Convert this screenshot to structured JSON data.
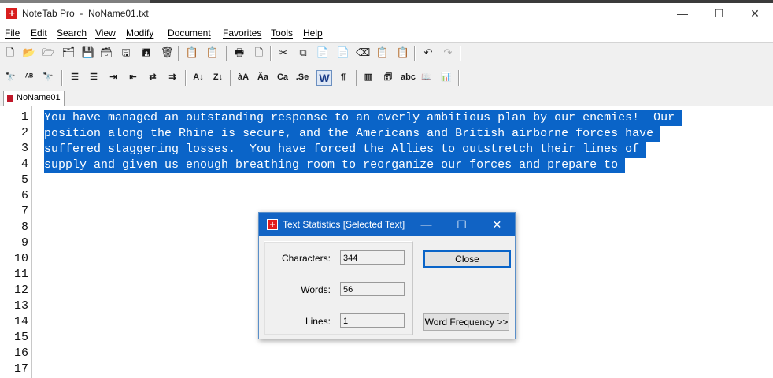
{
  "window": {
    "title": "NoteTab Pro  -  NoName01.txt",
    "controls": [
      "—",
      "☐",
      "✕"
    ]
  },
  "menu": [
    "File",
    "Edit",
    "Search",
    "View",
    "Modify",
    "Document",
    "Favorites",
    "Tools",
    "Help"
  ],
  "toolbar1": {
    "icons": [
      "new-file-icon",
      "open-file-icon",
      "open-folder-icon",
      "open-multiple-icon",
      "save-icon",
      "save-all-icon",
      "save-as-icon",
      "save-settings-icon",
      "delete-icon",
      "clip-icon",
      "clip-disabled-icon",
      "print-icon",
      "print-preview-icon",
      "cut-icon",
      "copy-icon",
      "paste-icon",
      "paste-special-icon",
      "eraser-icon",
      "clipboard-icon",
      "clipboard-paste-icon",
      "undo-icon",
      "redo-icon"
    ],
    "glyphs": [
      "🗋",
      "📂",
      "🗁",
      "🗂",
      "💾",
      "🗃",
      "🖫",
      "🖪",
      "🗑",
      "📋",
      "📋",
      "🖶",
      "🗋",
      "✂",
      "⧉",
      "📄",
      "📄",
      "⌫",
      "📋",
      "📋",
      "↶",
      "↷"
    ]
  },
  "toolbar2": {
    "icons": [
      "find-icon",
      "replace-icon",
      "find-disabled-icon",
      "bullets-icon",
      "numbering-icon",
      "indent-icon",
      "outdent-icon",
      "align-icon",
      "justify-icon",
      "sort-ascending-icon",
      "sort-descending-icon",
      "lowercase-icon",
      "uppercase-icon",
      "capitalize-icon",
      "sentence-case-icon",
      "word-wrap-icon",
      "paragraph-icon",
      "columns-icon",
      "clipbook-icon",
      "spellcheck-icon",
      "thesaurus-icon",
      "statistics-icon"
    ],
    "glyphs": [
      "🔭",
      "ᴬᴮ",
      "🔭",
      "☰",
      "☰",
      "⇥",
      "⇤",
      "⇄",
      "⇉",
      "A↓",
      "Z↓",
      "àA",
      "Äa",
      "Ca",
      ".Se",
      "W",
      "¶",
      "▥",
      "🗊",
      "abc",
      "📖",
      "📊"
    ]
  },
  "tab": {
    "label": "NoName01"
  },
  "editor": {
    "line_numbers": [
      "1",
      "2",
      "3",
      "4",
      "5",
      "6",
      "7",
      "8",
      "9",
      "10",
      "11",
      "12",
      "13",
      "14",
      "15",
      "16",
      "17"
    ],
    "lines": [
      "You have managed an outstanding response to an overly ambitious plan by our enemies!  Our ",
      "position along the Rhine is secure, and the Americans and British airborne forces have ",
      "suffered staggering losses.  You have forced the Allies to outstretch their lines of ",
      "supply and given us enough breathing room to reorganize our forces and prepare to "
    ]
  },
  "dialog": {
    "title": "Text Statistics [Selected Text]",
    "icon": "+",
    "controls": [
      "—",
      "☐",
      "✕"
    ],
    "characters_label": "Characters:",
    "characters_value": "344",
    "words_label": "Words:",
    "words_value": "56",
    "lines_label": "Lines:",
    "lines_value": "1",
    "close_label": "Close",
    "word_frequency_label": "Word Frequency  >>"
  },
  "colors": {
    "selection": "#0a64c8",
    "dialog_title": "#1163c4",
    "app_icon": "#d81e1e"
  }
}
